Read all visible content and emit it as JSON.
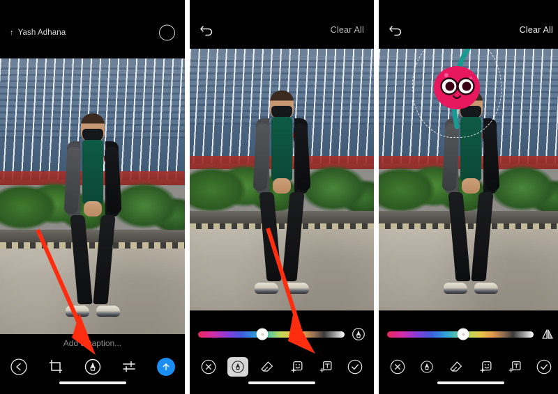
{
  "meta": {
    "kind": "three-panel-phone-screenshot-tutorial",
    "background_color": "#ffffff",
    "panel_background": "#000000",
    "annotation_arrow_color": "#ff2d10",
    "accent_blue": "#1b8ef2",
    "text_primary": "#efefef",
    "text_secondary": "#8b8b8b",
    "sticker_body_color": "#e8185f",
    "sticker_stem_color": "#1a9a8e"
  },
  "panel1": {
    "topbar": {
      "share_arrow_glyph": "↑",
      "sender_name": "Yash Adhana",
      "capture_button_label": ""
    },
    "caption": {
      "placeholder": "Add a caption..."
    },
    "toolbar": {
      "items": [
        {
          "name": "back-button",
          "label": ""
        },
        {
          "name": "crop-tool",
          "label": ""
        },
        {
          "name": "markup-tool",
          "label": ""
        },
        {
          "name": "adjust-tool",
          "label": ""
        },
        {
          "name": "send-button",
          "label": ""
        }
      ]
    },
    "annotation": {
      "type": "arrow",
      "points_to": "markup-tool",
      "color": "#ff2d10"
    }
  },
  "panel2": {
    "topbar": {
      "undo_label": "",
      "clear_all_label": "Clear All"
    },
    "color_slider": {
      "value_percent": 44,
      "end_icon": "pen-icon"
    },
    "toolbar": {
      "items": [
        {
          "name": "close-button",
          "label": "",
          "selected": false
        },
        {
          "name": "pen-tool",
          "label": "",
          "selected": true
        },
        {
          "name": "eraser-tool",
          "label": "",
          "selected": false
        },
        {
          "name": "sticker-tool",
          "label": "",
          "selected": false
        },
        {
          "name": "text-tool",
          "label": "",
          "selected": false
        },
        {
          "name": "confirm-button",
          "label": "",
          "selected": false
        }
      ]
    },
    "annotation": {
      "type": "arrow",
      "points_to": "sticker-tool",
      "color": "#ff2d10"
    }
  },
  "panel3": {
    "topbar": {
      "undo_label": "",
      "clear_all_label": "Clear All"
    },
    "color_slider": {
      "value_percent": 52,
      "end_icon": "mirror-flip-icon"
    },
    "sticker": {
      "name": "cherry-sticker",
      "selected": true,
      "selection_style": "dashed-outline"
    },
    "toolbar": {
      "items": [
        {
          "name": "close-button",
          "label": "",
          "selected": false
        },
        {
          "name": "pen-tool",
          "label": "",
          "selected": false
        },
        {
          "name": "eraser-tool",
          "label": "",
          "selected": false
        },
        {
          "name": "sticker-tool",
          "label": "",
          "selected": false
        },
        {
          "name": "text-tool",
          "label": "",
          "selected": false
        },
        {
          "name": "confirm-button",
          "label": "",
          "selected": false
        }
      ]
    }
  }
}
